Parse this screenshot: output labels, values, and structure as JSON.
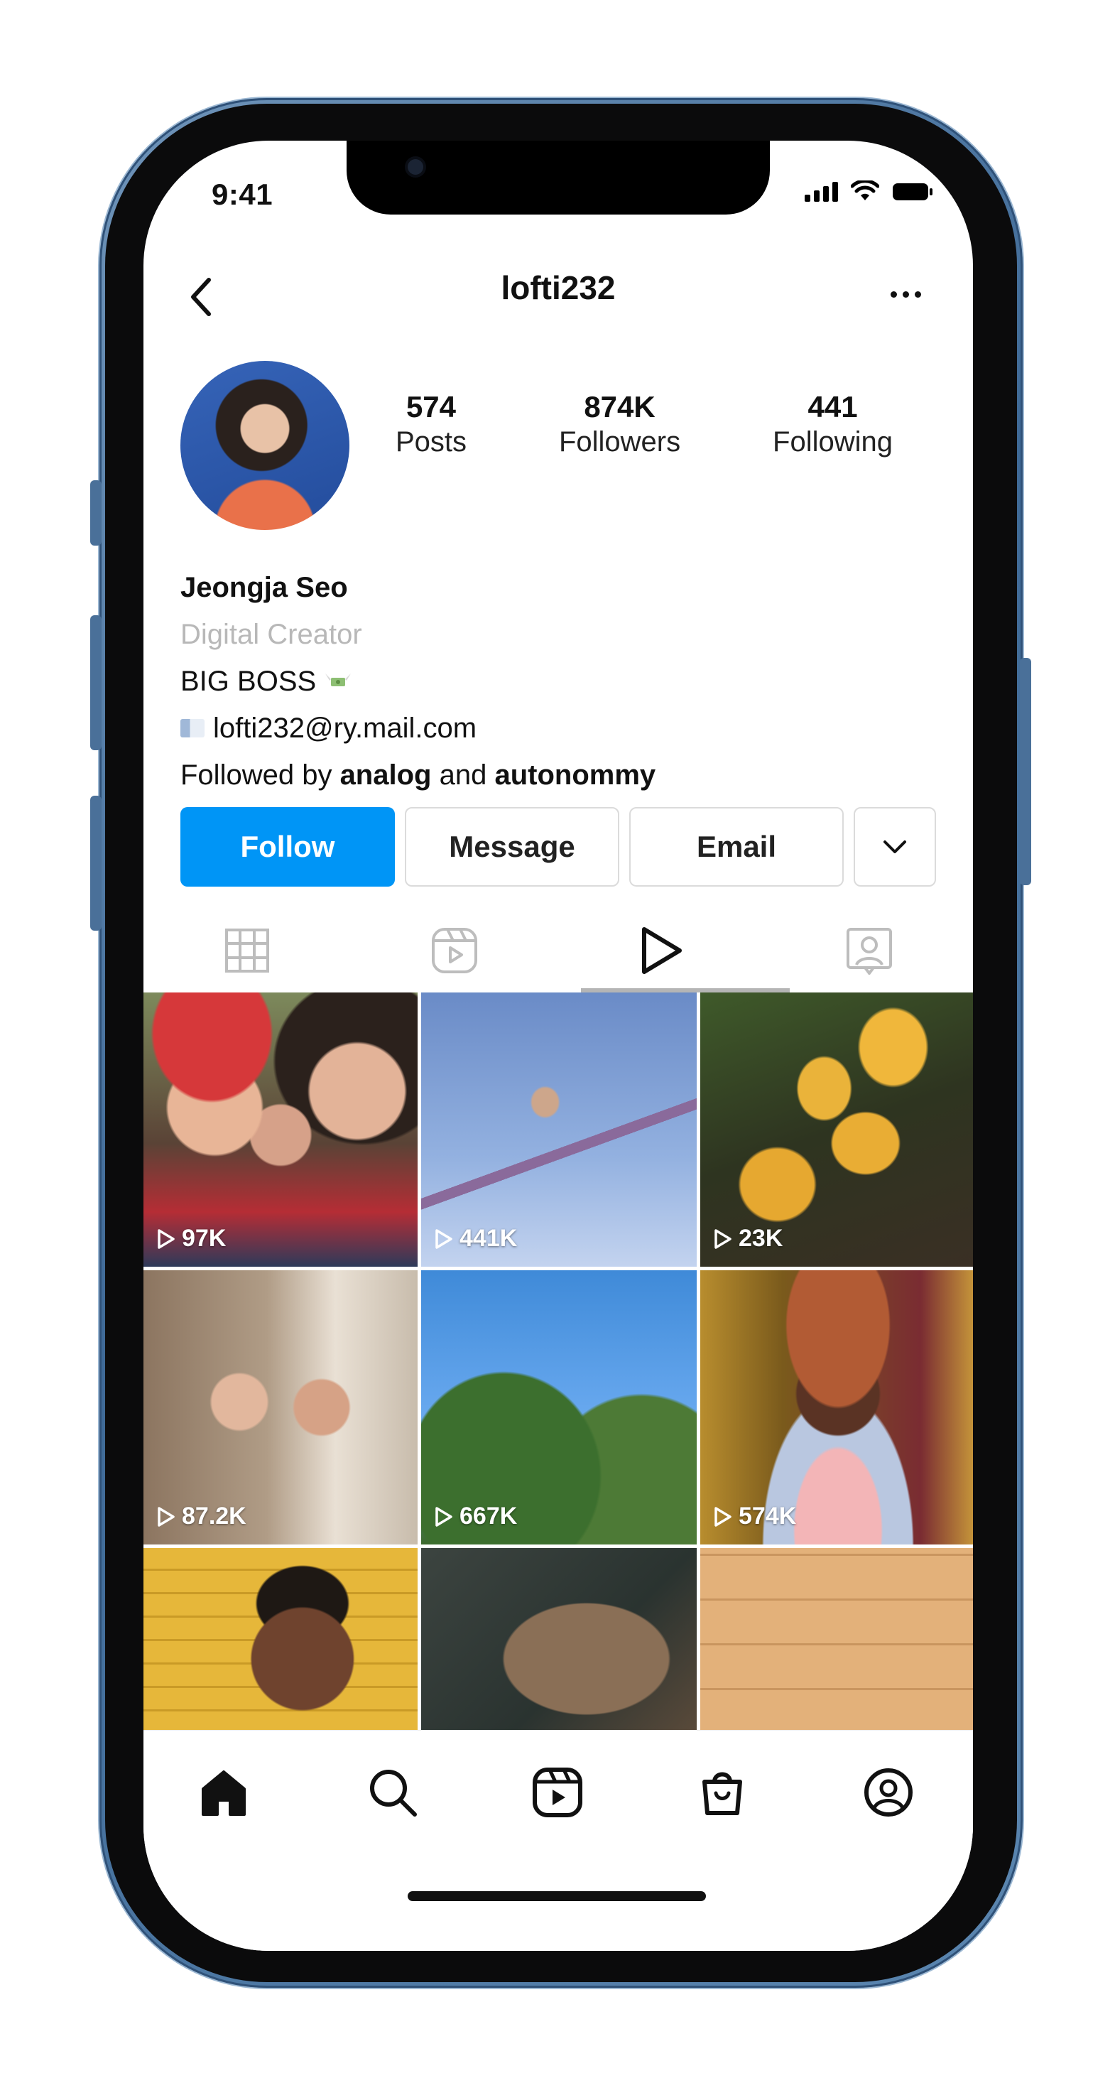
{
  "status_bar": {
    "time": "9:41"
  },
  "header": {
    "username": "lofti232"
  },
  "profile": {
    "stats": [
      {
        "value": "574",
        "label": "Posts"
      },
      {
        "value": "874K",
        "label": "Followers"
      },
      {
        "value": "441",
        "label": "Following"
      }
    ],
    "name": "Jeongja Seo",
    "category": "Digital Creator",
    "bio_line": "BIG BOSS",
    "email": "lofti232@ry.mail.com",
    "followed_by_prefix": "Followed by",
    "followed_by_user_1": "analog",
    "followed_by_and": "and",
    "followed_by_user_2": "autonommy"
  },
  "actions": {
    "follow_label": "Follow",
    "message_label": "Message",
    "email_label": "Email"
  },
  "tabs": [
    {
      "icon": "grid-icon"
    },
    {
      "icon": "reels-icon"
    },
    {
      "icon": "play-icon",
      "active": true
    },
    {
      "icon": "tagged-icon"
    }
  ],
  "grid": [
    {
      "views": "97K"
    },
    {
      "views": "441K"
    },
    {
      "views": "23K"
    },
    {
      "views": "87.2K"
    },
    {
      "views": "667K"
    },
    {
      "views": "574K"
    },
    {
      "views": ""
    },
    {
      "views": ""
    },
    {
      "views": ""
    }
  ],
  "tabbar": [
    {
      "icon": "home-icon",
      "active": true
    },
    {
      "icon": "search-icon"
    },
    {
      "icon": "reels-icon"
    },
    {
      "icon": "shop-icon"
    },
    {
      "icon": "profile-icon"
    }
  ],
  "colors": {
    "follow_button": "#0095f6",
    "phone_frame": "#4a76a3",
    "category_text": "#b8b8b8"
  }
}
